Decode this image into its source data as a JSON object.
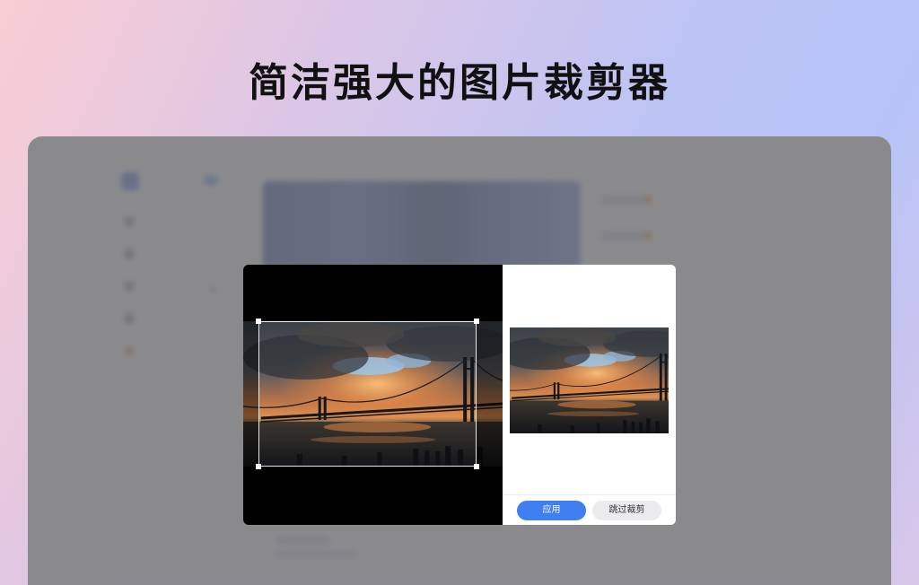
{
  "headline": "简洁强大的图片裁剪器",
  "dialog": {
    "apply_label": "应用",
    "skip_label": "跳过裁剪"
  },
  "colors": {
    "accent": "#3f7ff0",
    "overlay": "#6c6c70"
  }
}
